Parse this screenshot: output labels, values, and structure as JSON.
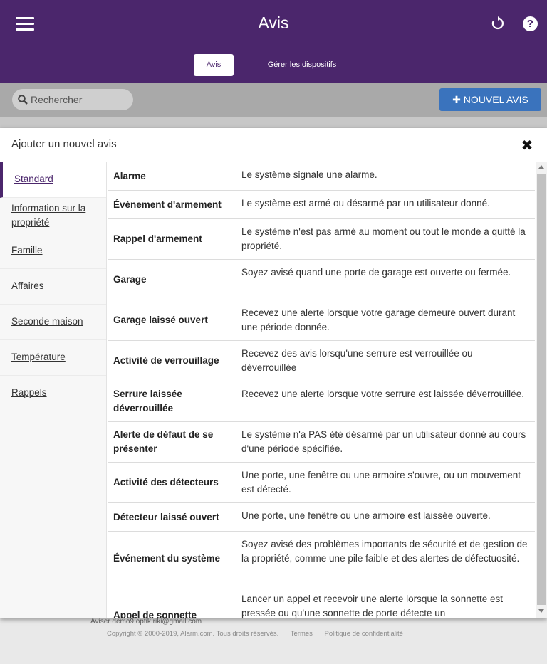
{
  "header": {
    "title": "Avis",
    "tabs": [
      {
        "label": "Avis",
        "active": true
      },
      {
        "label": "Gérer les dispositifs",
        "active": false
      }
    ],
    "icons": {
      "menu": "hamburger-menu-icon",
      "refresh": "refresh-icon",
      "help": "help-icon"
    },
    "help_glyph": "?"
  },
  "toolbar": {
    "search_placeholder": "Rechercher",
    "new_button_label": "NOUVEL AVIS",
    "new_button_glyph": "✚"
  },
  "modal": {
    "title": "Ajouter un nouvel avis",
    "close_glyph": "✖",
    "sidebar": [
      {
        "label": "Standard",
        "active": true
      },
      {
        "label": "Information sur la propriété",
        "active": false
      },
      {
        "label": "Famille",
        "active": false
      },
      {
        "label": "Affaires",
        "active": false
      },
      {
        "label": "Seconde maison",
        "active": false
      },
      {
        "label": "Température",
        "active": false
      },
      {
        "label": "Rappels",
        "active": false
      }
    ],
    "rows": [
      {
        "name": "Alarme",
        "desc": "Le système signale une alarme."
      },
      {
        "name": "Événement d'armement",
        "desc": "Le système est armé ou désarmé par un utilisateur donné."
      },
      {
        "name": "Rappel d'armement",
        "desc": "Le système n'est pas armé au moment ou tout le monde a quitté la propriété."
      },
      {
        "name": "Garage",
        "desc": "Soyez avisé quand une porte de garage est ouverte ou fermée."
      },
      {
        "name": "Garage laissé ouvert",
        "desc": "Recevez une alerte lorsque votre garage demeure ouvert durant une période donnée."
      },
      {
        "name": "Activité de verrouillage",
        "desc": "Recevez des avis lorsqu'une serrure est verrouillée ou déverrouillée"
      },
      {
        "name": "Serrure laissée déverrouillée",
        "desc": "Recevez une alerte lorsque votre serrure est laissée déverrouillée."
      },
      {
        "name": "Alerte de défaut de se présenter",
        "desc": "Le système n'a PAS été désarmé par un utilisateur donné au cours d'une période spécifiée."
      },
      {
        "name": "Activité des détecteurs",
        "desc": "Une porte, une fenêtre ou une armoire s'ouvre, ou un mouvement est détecté."
      },
      {
        "name": "Détecteur laissé ouvert",
        "desc": "Une porte, une fenêtre ou une armoire est laissée ouverte."
      },
      {
        "name": "Événement du système",
        "desc": "Soyez avisé des problèmes importants de sécurité et de gestion de la propriété, comme une pile faible et des alertes de défectuosité."
      },
      {
        "name": "Appel de sonnette",
        "desc": "Lancer un appel et recevoir une alerte lorsque la sonnette est pressée ou qu'une sonnette de porte détecte un"
      }
    ]
  },
  "footer": {
    "email": "Aviser demo9.optik.riki@gmail.com",
    "copyright": "Copyright © 2000-2019, Alarm.com. Tous droits réservés.",
    "terms": "Termes",
    "privacy": "Politique de confidentialité"
  },
  "colors": {
    "brand": "#4b266c",
    "button": "#3a73bd"
  }
}
